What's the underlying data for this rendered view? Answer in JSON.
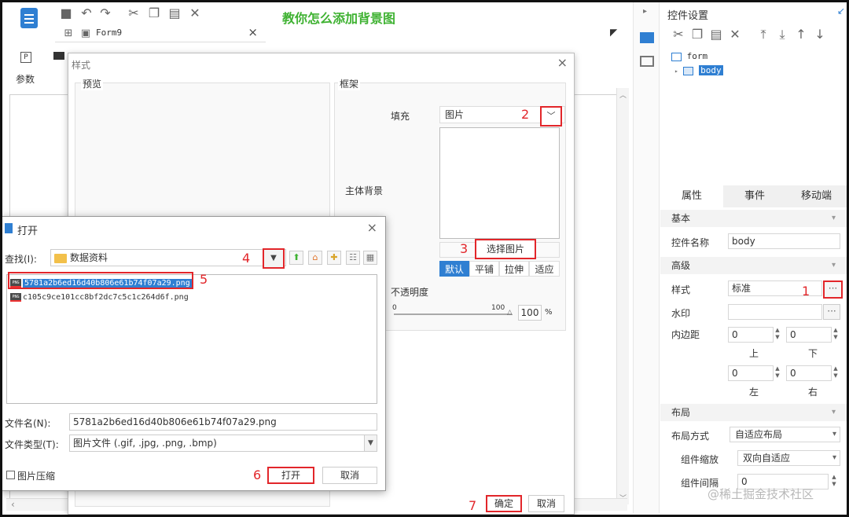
{
  "banner": {
    "title": "教你怎么添加背景图"
  },
  "editor": {
    "tab_name": "Form9",
    "tab_close": "×",
    "params_icon": "P",
    "params_label": "参数"
  },
  "right_panel": {
    "title": "控件设置",
    "tree": {
      "root": "form",
      "child": "body"
    },
    "tabs": [
      "属性",
      "事件",
      "移动端"
    ],
    "sections": {
      "basic": "基本",
      "advanced": "高级",
      "layout": "布局"
    },
    "props": {
      "name_label": "控件名称",
      "name_value": "body",
      "style_label": "样式",
      "style_value": "标准",
      "style_btn": "···",
      "watermark_label": "水印",
      "watermark_btn": "···",
      "padding_label": "内边距",
      "pad_top": "0",
      "pad_bottom": "0",
      "pad_left": "0",
      "pad_right": "0",
      "cap_top": "上",
      "cap_bottom": "下",
      "cap_left": "左",
      "cap_right": "右",
      "layout_mode_label": "布局方式",
      "layout_mode_value": "自适应布局",
      "zoom_label": "组件缩放",
      "zoom_value": "双向自适应",
      "gap_label": "组件间隔",
      "gap_value": "0"
    }
  },
  "style_dialog": {
    "title": "样式",
    "close": "×",
    "preview_label": "预览",
    "frame_label": "框架",
    "fill_label": "填充",
    "fill_value": "图片",
    "main_bg_label": "主体背景",
    "choose_image": "选择图片",
    "modes": [
      "默认",
      "平铺",
      "拉伸",
      "适应"
    ],
    "opacity_label": "不透明度",
    "slider_min": "0",
    "slider_max": "100",
    "opacity_value": "100",
    "percent": "%",
    "ok": "确定",
    "cancel": "取消"
  },
  "open_dialog": {
    "title": "打开",
    "close": "×",
    "look_in_label": "查找(I):",
    "look_in_value": "数据资料",
    "files": [
      {
        "name": "5781a2b6ed16d40b806e61b74f07a29.png",
        "selected": true
      },
      {
        "name": "c105c9ce101cc8bf2dc7c5c1c264d6f.png",
        "selected": false
      }
    ],
    "filename_label": "文件名(N):",
    "filename_value": "5781a2b6ed16d40b806e61b74f07a29.png",
    "filetype_label": "文件类型(T):",
    "filetype_value": "图片文件 (.gif, .jpg, .png, .bmp)",
    "compress_label": "图片压缩",
    "open_btn": "打开",
    "cancel_btn": "取消"
  },
  "steps": [
    "1",
    "2",
    "3",
    "4",
    "5",
    "6",
    "7"
  ],
  "watermark": "@稀土掘金技术社区",
  "colors": {
    "accent": "#2f7fd2",
    "highlight": "#e2262a",
    "banner": "#3fb232"
  }
}
